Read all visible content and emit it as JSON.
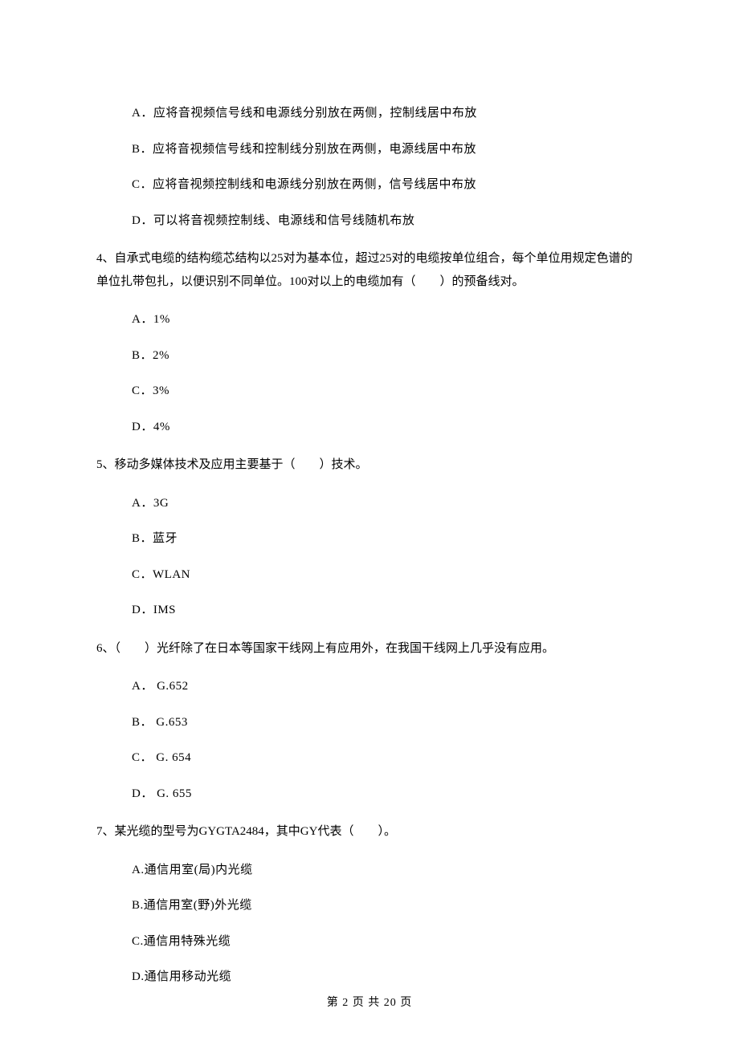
{
  "q_prev_options": {
    "A": "A．应将音视频信号线和电源线分别放在两侧，控制线居中布放",
    "B": "B．应将音视频信号线和控制线分别放在两侧，电源线居中布放",
    "C": "C．应将音视频控制线和电源线分别放在两侧，信号线居中布放",
    "D": "D．可以将音视频控制线、电源线和信号线随机布放"
  },
  "q4": {
    "text": "4、自承式电缆的结构缆芯结构以25对为基本位，超过25对的电缆按单位组合，每个单位用规定色谱的单位扎带包扎，以便识别不同单位。100对以上的电缆加有（　　）的预备线对。",
    "options": {
      "A": "A．1%",
      "B": "B．2%",
      "C": "C．3%",
      "D": "D．4%"
    }
  },
  "q5": {
    "text": "5、移动多媒体技术及应用主要基于（　　）技术。",
    "options": {
      "A": "A．3G",
      "B": "B．蓝牙",
      "C": "C．WLAN",
      "D": "D．IMS"
    }
  },
  "q6": {
    "text": "6、（　　）光纤除了在日本等国家干线网上有应用外，在我国干线网上几乎没有应用。",
    "options": {
      "A": "A． G.652",
      "B": "B． G.653",
      "C": "C． G. 654",
      "D": "D． G. 655"
    }
  },
  "q7": {
    "text": "7、某光缆的型号为GYGTA2484，其中GY代表（　　）。",
    "options": {
      "A": "A.通信用室(局)内光缆",
      "B": "B.通信用室(野)外光缆",
      "C": "C.通信用特殊光缆",
      "D": "D.通信用移动光缆"
    }
  },
  "footer": "第 2 页 共 20 页"
}
